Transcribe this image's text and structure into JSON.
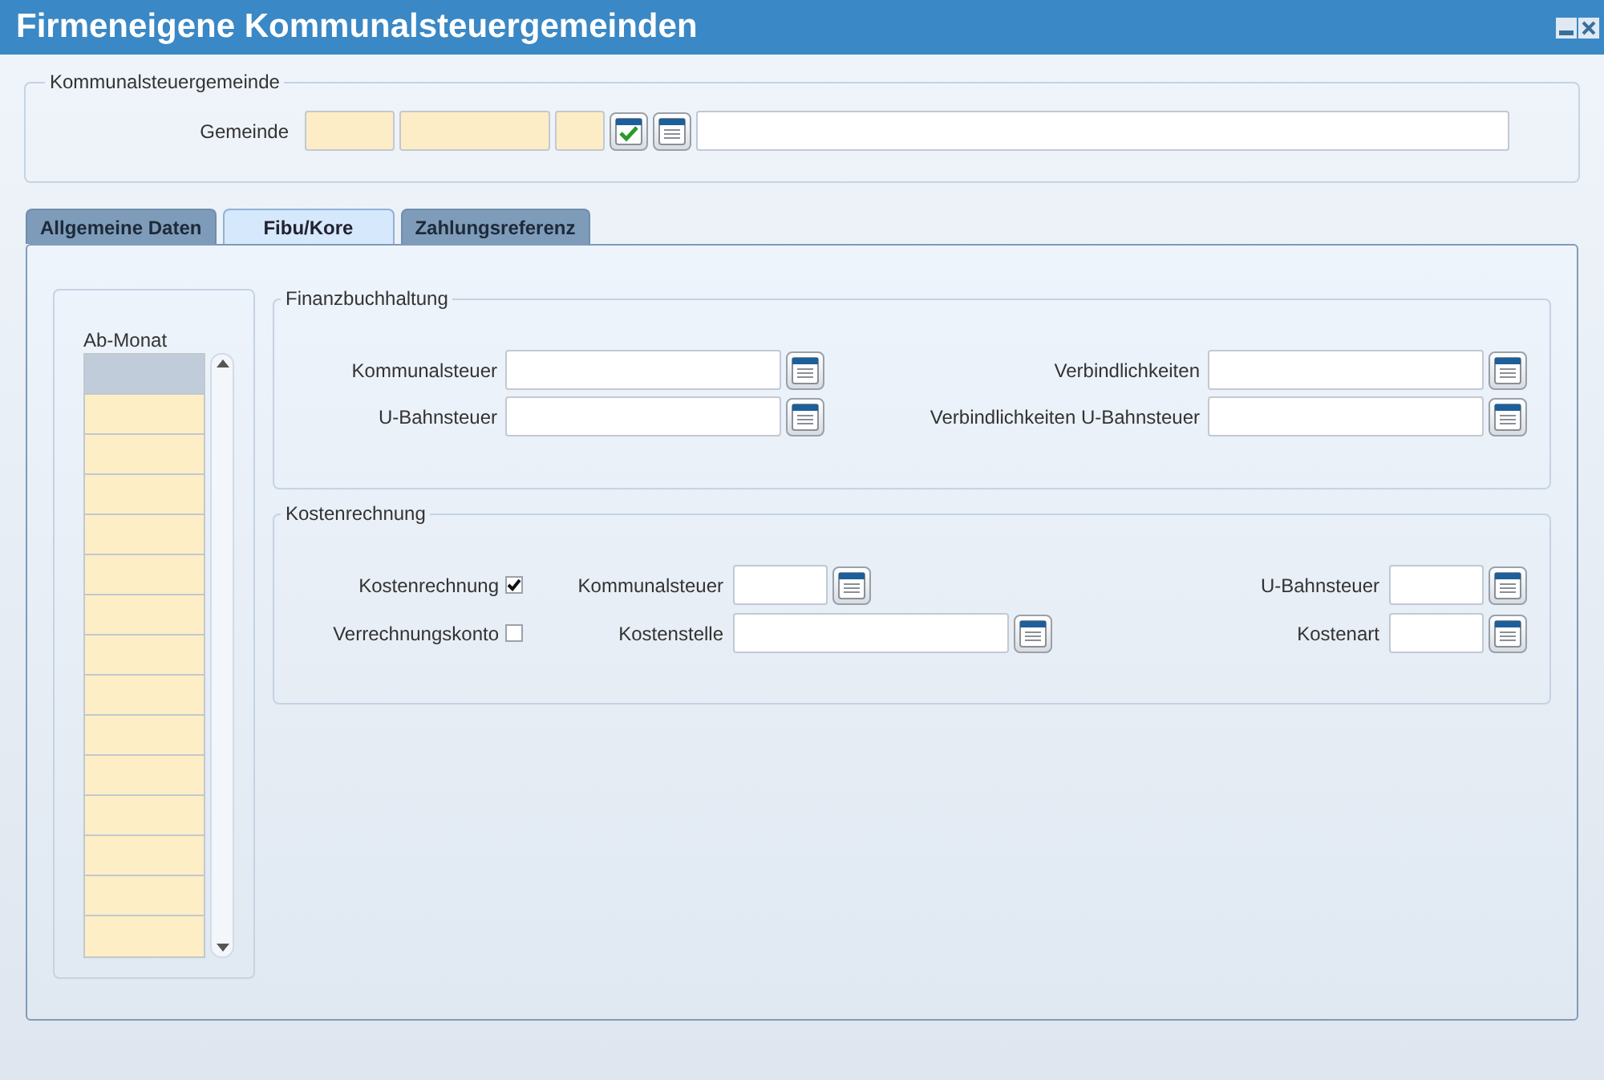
{
  "window": {
    "title": "Firmeneigene Kommunalsteuergemeinden"
  },
  "header_group": {
    "legend": "Kommunalsteuergemeinde",
    "label": "Gemeinde"
  },
  "tabs": [
    {
      "label": "Allgemeine Daten",
      "selected": false
    },
    {
      "label": "Fibu/Kore",
      "selected": true
    },
    {
      "label": "Zahlungsreferenz",
      "selected": false
    }
  ],
  "month_list": {
    "header": "Ab-Monat",
    "rows": [
      {
        "selected": true
      },
      {
        "selected": false
      },
      {
        "selected": false
      },
      {
        "selected": false
      },
      {
        "selected": false
      },
      {
        "selected": false
      },
      {
        "selected": false
      },
      {
        "selected": false
      },
      {
        "selected": false
      },
      {
        "selected": false
      },
      {
        "selected": false
      },
      {
        "selected": false
      },
      {
        "selected": false
      },
      {
        "selected": false
      },
      {
        "selected": false
      }
    ]
  },
  "fibu": {
    "legend": "Finanzbuchhaltung",
    "rows": [
      [
        {
          "label": "Kommunalsteuer"
        },
        {
          "label": "Verbindlichkeiten"
        }
      ],
      [
        {
          "label": "U-Bahnsteuer"
        },
        {
          "label": "Verbindlichkeiten U-Bahnsteuer"
        }
      ]
    ]
  },
  "kore": {
    "legend": "Kostenrechnung",
    "rows": [
      {
        "checkbox": {
          "label": "Kostenrechnung",
          "checked": true
        },
        "fields": [
          {
            "label": "Kommunalsteuer"
          },
          {
            "label": "U-Bahnsteuer"
          }
        ]
      },
      {
        "checkbox": {
          "label": "Verrechnungskonto",
          "checked": false
        },
        "fields": [
          {
            "label": "Kostenstelle"
          },
          {
            "label": "Kostenart"
          }
        ]
      }
    ]
  }
}
